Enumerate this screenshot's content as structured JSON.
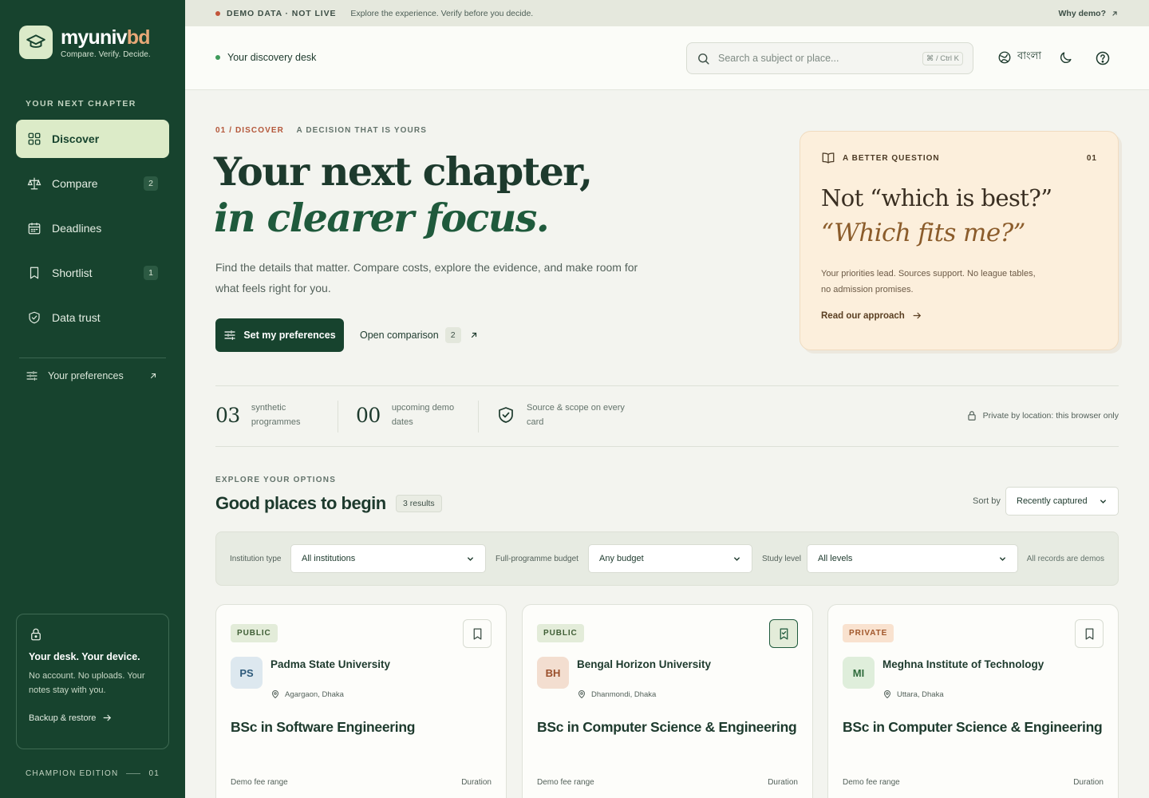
{
  "brand": {
    "name_main": "myuniv",
    "name_accent": "bd",
    "tagline": "Compare. Verify. Decide."
  },
  "sidebar": {
    "section_label": "YOUR NEXT CHAPTER",
    "items": [
      {
        "label": "Discover",
        "icon": "grid-icon",
        "active": true
      },
      {
        "label": "Compare",
        "icon": "scale-icon",
        "count": "2"
      },
      {
        "label": "Deadlines",
        "icon": "calendar-icon"
      },
      {
        "label": "Shortlist",
        "icon": "bookmark-icon",
        "count": "1"
      },
      {
        "label": "Data trust",
        "icon": "shield-icon"
      }
    ],
    "preferences_link": "Your preferences",
    "privacy": {
      "title": "Your desk. Your device.",
      "body": "No account. No uploads. Your notes stay with you.",
      "link": "Backup & restore"
    },
    "edition": {
      "label": "CHAMPION EDITION",
      "number": "01"
    }
  },
  "banner": {
    "tag": "DEMO DATA · NOT LIVE",
    "text": "Explore the experience. Verify before you decide.",
    "link": "Why demo?"
  },
  "header": {
    "desk": "Your discovery desk",
    "search_placeholder": "Search a subject or place...",
    "search_shortcut": "⌘ / Ctrl K",
    "language": "বাংলা"
  },
  "hero": {
    "eyebrow_num": "01 / DISCOVER",
    "eyebrow_text": "A DECISION THAT IS YOURS",
    "title_line1": "Your next chapter,",
    "title_line2": "in clearer focus.",
    "subtitle": "Find the details that matter. Compare costs, explore the evidence, and make room for what feels right for you.",
    "primary_button": "Set my preferences",
    "secondary_link": "Open comparison",
    "secondary_count": "2"
  },
  "question_card": {
    "eyebrow": "A BETTER QUESTION",
    "number": "01",
    "line1": "Not “which is best?”",
    "line2": "“Which fits me?”",
    "body": "Your priorities lead. Sources support. No league tables, no admission promises.",
    "link": "Read our approach"
  },
  "stats": [
    {
      "value": "03",
      "label": "synthetic programmes"
    },
    {
      "value": "00",
      "label": "upcoming demo dates"
    },
    {
      "label": "Source & scope on every card"
    }
  ],
  "private_note": "Private by location: this browser only",
  "explore": {
    "eyebrow": "EXPLORE YOUR OPTIONS",
    "title": "Good places to begin",
    "count": "3 results",
    "sort_label": "Sort by",
    "sort_value": "Recently captured"
  },
  "filters": {
    "institution_label": "Institution type",
    "institution_value": "All institutions",
    "budget_label": "Full-programme budget",
    "budget_value": "Any budget",
    "level_label": "Study level",
    "level_value": "All levels",
    "note": "All records are demos"
  },
  "cards": [
    {
      "badge": "PUBLIC",
      "initials": "PS",
      "name": "Padma State University",
      "location": "Agargaon, Dhaka",
      "programme": "BSc in Software Engineering",
      "fee_label": "Demo fee range",
      "duration_label": "Duration",
      "saved": false
    },
    {
      "badge": "PUBLIC",
      "initials": "BH",
      "name": "Bengal Horizon University",
      "location": "Dhanmondi, Dhaka",
      "programme": "BSc in Computer Science & Engineering",
      "fee_label": "Demo fee range",
      "duration_label": "Duration",
      "saved": true
    },
    {
      "badge": "PRIVATE",
      "initials": "MI",
      "name": "Meghna Institute of Technology",
      "location": "Uttara, Dhaka",
      "programme": "BSc in Computer Science & Engineering",
      "fee_label": "Demo fee range",
      "duration_label": "Duration",
      "saved": false
    }
  ],
  "colors": {
    "sidebar_bg": "#17432e",
    "accent_brand": "#e7a877",
    "active_nav": "#dcebc8",
    "alert_dot": "#c2553a",
    "question_card_bg": "#fcefdc"
  }
}
